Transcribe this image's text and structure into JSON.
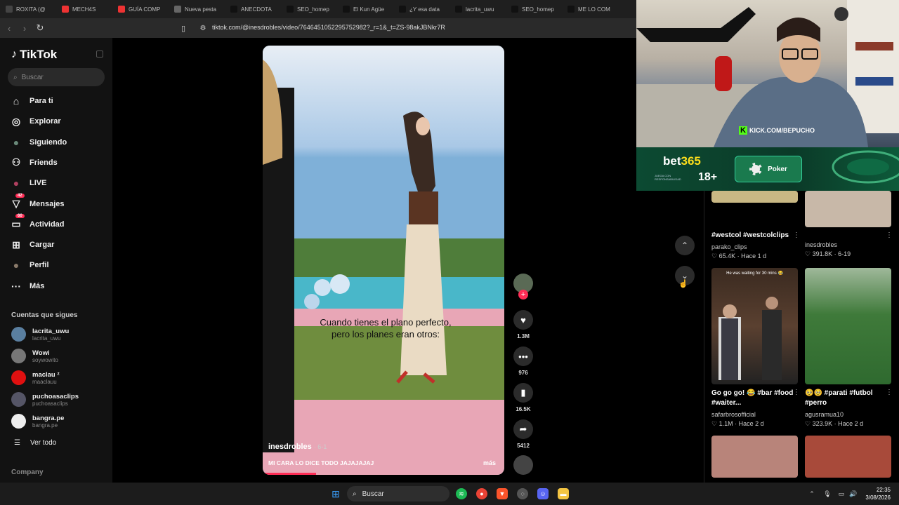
{
  "browser": {
    "tabs": [
      {
        "label": "ROXITA (@",
        "color": "#444"
      },
      {
        "label": "MECH4S",
        "color": "#e33"
      },
      {
        "label": "GUÍA COMP",
        "color": "#e33"
      },
      {
        "label": "Nueva pesta",
        "color": "#666"
      },
      {
        "label": "ANECDOTA",
        "color": "#111"
      },
      {
        "label": "SEO_homep",
        "color": "#111"
      },
      {
        "label": "El Kun Agüe",
        "color": "#111"
      },
      {
        "label": "¿Y esa data",
        "color": "#111"
      },
      {
        "label": "lacrita_uwu",
        "color": "#111"
      },
      {
        "label": "SEO_homep",
        "color": "#111"
      },
      {
        "label": "ME LO COM",
        "color": "#111"
      }
    ],
    "url": "tiktok.com/@inesdrobles/video/7646451052295752982?_r=1&_t=ZS-98akJBNkr7R"
  },
  "sidebar": {
    "logo": "TikTok",
    "search_placeholder": "Buscar",
    "nav": [
      {
        "label": "Para ti",
        "icon": "home-icon"
      },
      {
        "label": "Explorar",
        "icon": "compass-icon"
      },
      {
        "label": "Siguiendo",
        "icon": "following-avatar-icon"
      },
      {
        "label": "Friends",
        "icon": "friends-icon"
      },
      {
        "label": "LIVE",
        "icon": "live-icon"
      },
      {
        "label": "Mensajes",
        "icon": "messages-icon",
        "badge": "42"
      },
      {
        "label": "Actividad",
        "icon": "activity-icon",
        "badge": "60"
      },
      {
        "label": "Cargar",
        "icon": "upload-icon"
      },
      {
        "label": "Perfil",
        "icon": "profile-avatar-icon"
      },
      {
        "label": "Más",
        "icon": "more-icon"
      }
    ],
    "following_title": "Cuentas que sigues",
    "accounts": [
      {
        "name": "lacrita_uwu",
        "handle": "lacrita_uwu",
        "color": "#5a7fa0"
      },
      {
        "name": "Wowi",
        "handle": "soywowito",
        "color": "#777"
      },
      {
        "name": "maclau ᶻ",
        "handle": "maaclauu",
        "color": "#e01010"
      },
      {
        "name": "puchoasaclips",
        "handle": "puchoasaclips",
        "color": "#556"
      },
      {
        "name": "bangra.pe",
        "handle": "bangra.pe",
        "color": "#eee"
      }
    ],
    "see_all": "Ver todo",
    "company": "Company"
  },
  "video": {
    "caption": "Cuando tienes el plano perfecto, pero los planes eran otros:",
    "author": "inesdrobles",
    "date": "· 6-1",
    "description": "MI CARA LO DICE TODO JAJAJAJAJ",
    "more": "más",
    "progress": 0.22,
    "actions": {
      "likes": "1.3M",
      "comments": "976",
      "saves": "16.5K",
      "shares": "5412"
    }
  },
  "overlay": {
    "kick_text": "KICK.COM/BEPUCHO",
    "bet_logo_a": "bet",
    "bet_logo_b": "365",
    "bet_age": "18+",
    "bet_small": "JUEGA CON RESPONSABILIDAD",
    "poker": "Poker"
  },
  "grid": [
    {
      "title": "#westcol #westcolclips",
      "author": "parako_clips",
      "likes": "65.4K",
      "ago": "Hace 1 d"
    },
    {
      "title": "",
      "author": "inesdrobles",
      "likes": "391.8K",
      "ago": "6-19"
    },
    {
      "title": "Go go go! 😂 #bar #food #waiter...",
      "author": "safarbrosofficial",
      "likes": "1.1M",
      "ago": "Hace 2 d",
      "overlay": "He was waiting for 30 mins 😂"
    },
    {
      "title": "🥺🥺 #parati #futbol #perro",
      "author": "agusramua10",
      "likes": "323.9K",
      "ago": "Hace 2 d"
    }
  ],
  "taskbar": {
    "search": "Buscar",
    "time": "22:35",
    "date": "3/08/2026"
  }
}
